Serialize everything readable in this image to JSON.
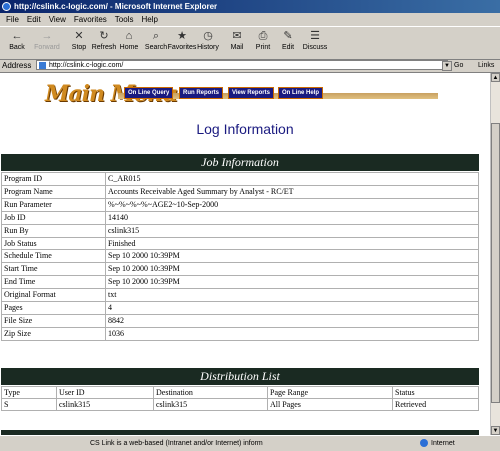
{
  "window": {
    "title": "http://cslink.c-logic.com/ - Microsoft Internet Explorer"
  },
  "menu": [
    "File",
    "Edit",
    "View",
    "Favorites",
    "Tools",
    "Help"
  ],
  "toolbar": [
    {
      "label": "Back",
      "icon": "back-arrow-icon",
      "glyph": "←",
      "disabled": false
    },
    {
      "label": "Forward",
      "icon": "forward-arrow-icon",
      "glyph": "→",
      "disabled": true
    },
    {
      "label": "Stop",
      "icon": "stop-icon",
      "glyph": "✕",
      "disabled": false
    },
    {
      "label": "Refresh",
      "icon": "refresh-icon",
      "glyph": "↻",
      "disabled": false
    },
    {
      "label": "Home",
      "icon": "home-icon",
      "glyph": "⌂",
      "disabled": false
    },
    {
      "label": "Search",
      "icon": "search-icon",
      "glyph": "⌕",
      "disabled": false
    },
    {
      "label": "Favorites",
      "icon": "favorites-icon",
      "glyph": "★",
      "disabled": false
    },
    {
      "label": "History",
      "icon": "history-icon",
      "glyph": "◷",
      "disabled": false
    },
    {
      "label": "Mail",
      "icon": "mail-icon",
      "glyph": "✉",
      "disabled": false
    },
    {
      "label": "Print",
      "icon": "print-icon",
      "glyph": "⎙",
      "disabled": false
    },
    {
      "label": "Edit",
      "icon": "edit-icon",
      "glyph": "✎",
      "disabled": false
    },
    {
      "label": "Discuss",
      "icon": "discuss-icon",
      "glyph": "☰",
      "disabled": false
    }
  ],
  "address": {
    "label": "Address",
    "url": "http://cslink.c-logic.com/",
    "go": "Go",
    "links": "Links »"
  },
  "page": {
    "logo": "Main Menu",
    "nav": [
      "On Line Query",
      "Run Reports",
      "View Reports",
      "On Line Help"
    ],
    "title": "Log Information",
    "job_header": "Job Information",
    "job_rows": [
      {
        "key": "Program ID",
        "value": "C_AR015"
      },
      {
        "key": "Program Name",
        "value": "Accounts Receivable Aged Summary by Analyst - RC/ET"
      },
      {
        "key": "Run Parameter",
        "value": "%~%~%~%~AGE2~10-Sep-2000"
      },
      {
        "key": "Job ID",
        "value": "14140"
      },
      {
        "key": "Run By",
        "value": "cslink315"
      },
      {
        "key": "Job Status",
        "value": "Finished"
      },
      {
        "key": "Schedule Time",
        "value": "Sep 10 2000 10:39PM"
      },
      {
        "key": "Start Time",
        "value": "Sep 10 2000 10:39PM"
      },
      {
        "key": "End Time",
        "value": "Sep 10 2000 10:39PM"
      },
      {
        "key": "Original Format",
        "value": "txt"
      },
      {
        "key": "Pages",
        "value": "4"
      },
      {
        "key": "File Size",
        "value": "8842"
      },
      {
        "key": "Zip Size",
        "value": "1036"
      }
    ],
    "dist_header": "Distribution List",
    "dist_columns": [
      "Type",
      "User ID",
      "Destination",
      "Page Range",
      "Status"
    ],
    "dist_rows": [
      [
        "S",
        "cslink315",
        "cslink315",
        "All Pages",
        "Retrieved"
      ]
    ]
  },
  "status": {
    "text": "CS Link is a web-based (Intranet and/or Internet) inform",
    "zone": "Internet"
  }
}
